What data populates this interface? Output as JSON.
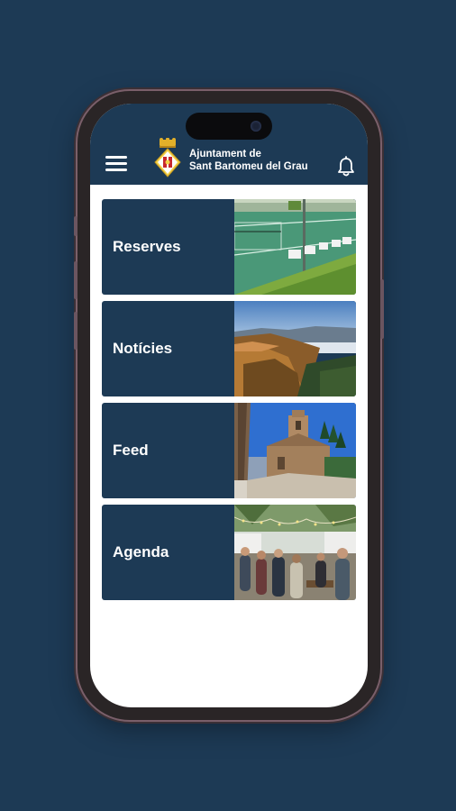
{
  "header": {
    "title_line1": "Ajuntament de",
    "title_line2": "Sant Bartomeu del Grau"
  },
  "icons": {
    "menu": "hamburger-menu-icon",
    "notifications": "bell-icon",
    "logo": "municipal-coat-of-arms"
  },
  "menu_items": [
    {
      "label": "Reserves",
      "image": "tennis-court-photo"
    },
    {
      "label": "Notícies",
      "image": "landscape-valley-photo"
    },
    {
      "label": "Feed",
      "image": "church-tower-photo"
    },
    {
      "label": "Agenda",
      "image": "street-market-photo"
    }
  ],
  "colors": {
    "background": "#1d3a55",
    "card": "#1d3a55",
    "screen": "#ffffff"
  }
}
